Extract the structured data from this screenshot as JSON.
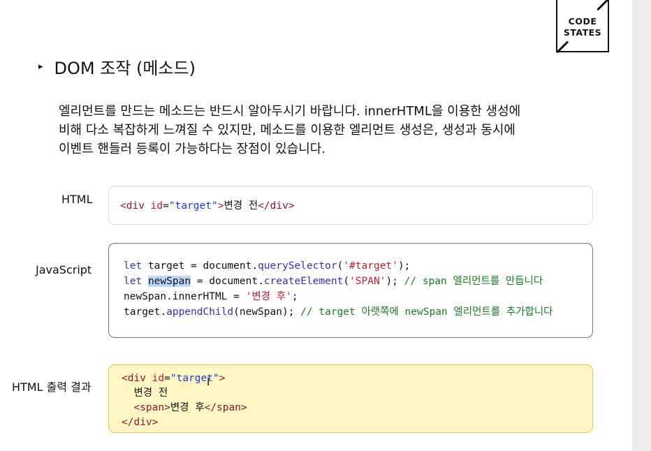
{
  "logo": {
    "line1": "CODE",
    "line2": "STATES"
  },
  "section": {
    "bullet": "▸",
    "title": "DOM 조작 (메소드)"
  },
  "description": [
    "엘리먼트를 만드는 메소드는 반드시 알아두시기 바랍니다. innerHTML을 이용한 생성에",
    "비해 다소 복잡하게 느껴질 수 있지만, 메소드를 이용한 엘리먼트 생성은, 생성과 동시에",
    "이벤트 핸들러 등록이 가능하다는 장점이 있습니다."
  ],
  "labels": {
    "html": "HTML",
    "javascript": "JavaScript",
    "output": "HTML 출력 결과"
  },
  "html_code": {
    "open_tag": "<div",
    "attr": "id",
    "eq": "=",
    "attr_value": "\"target\"",
    "gt": ">",
    "text": "변경 전",
    "close_tag": "</div>"
  },
  "js_code": {
    "line1": {
      "kw": "let",
      "rest": " target = document.",
      "method": "querySelector",
      "open": "(",
      "str": "'#target'",
      "close": ");"
    },
    "line2": {
      "kw": "let",
      "space": " ",
      "var": "newSpan",
      "rest": " = document.",
      "method": "createElement",
      "open": "(",
      "str": "'SPAN'",
      "close": "); ",
      "comment": "// span 엘리먼트를 만듭니다"
    },
    "line3": {
      "rest": "newSpan.innerHTML = ",
      "str": "'변경 후'",
      "close": ";"
    },
    "line4": {
      "rest": "target.",
      "method": "appendChild",
      "args": "(newSpan); ",
      "comment": "// target 아랫쪽에 newSpan 엘리먼트를 추가합니다"
    }
  },
  "output_code": {
    "line1_open": "<div",
    "line1_attr": "id",
    "line1_eq": "=",
    "line1_value": "\"target\"",
    "line1_gt": ">",
    "line2": "  변경 전",
    "line3_open": "  <span>",
    "line3_text": "변경 후",
    "line3_close": "</span>",
    "line4": "</div>"
  },
  "cursor": "I"
}
